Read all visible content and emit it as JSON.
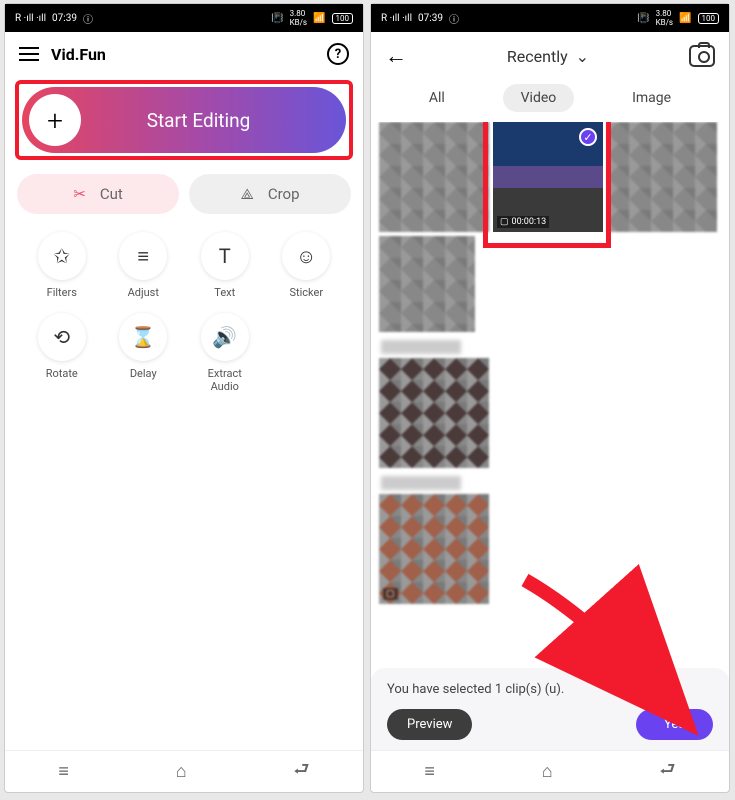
{
  "status": {
    "signal": "R ·ıll ·ıll",
    "time": "07:39",
    "info": "ⓘ",
    "battery": "100"
  },
  "left": {
    "appName": "Vid.Fun",
    "startEditing": "Start Editing",
    "cut": "Cut",
    "crop": "Crop",
    "tools": {
      "filters": "Filters",
      "adjust": "Adjust",
      "text": "Text",
      "sticker": "Sticker",
      "rotate": "Rotate",
      "delay": "Delay",
      "extractAudio": "Extract\nAudio"
    }
  },
  "right": {
    "recently": "Recently",
    "tabs": {
      "all": "All",
      "video": "Video",
      "image": "Image"
    },
    "selectedDuration": "00:00:13",
    "selectionText": "You have selected 1 clip(s) (u",
    "selectionTextEnd": ").",
    "preview": "Preview",
    "yes": "Yes"
  }
}
